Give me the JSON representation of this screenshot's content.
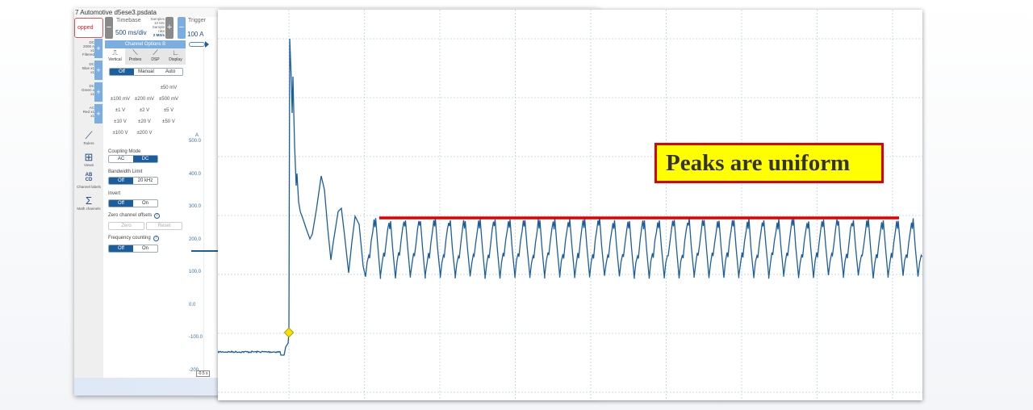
{
  "window": {
    "title": "7 Automotive d5ese3.psdata",
    "status": "opped"
  },
  "timebase": {
    "label": "Timebase",
    "value": "500 ms/div",
    "samples_label": "Samples",
    "samples": "10 MS",
    "rate_label": "Sample rate",
    "rate": "2 MS/s",
    "minus": "−",
    "plus": "+"
  },
  "trigger": {
    "label": "Trigger",
    "value": "100 A",
    "minus": "−"
  },
  "channels": [
    {
      "l1": "DC",
      "l2": "2000 A",
      "l3": "x1",
      "l4": "Filtered"
    },
    {
      "l1": "DC",
      "l2": "Blue x1",
      "l3": "x1",
      "l4": ""
    },
    {
      "l1": "DC",
      "l2": "Green x",
      "l3": "x1",
      "l4": ""
    },
    {
      "l1": "AC",
      "l2": "Red x1",
      "l3": "x1",
      "l4": ""
    }
  ],
  "channel_plus": "+",
  "tools": [
    {
      "label": "Rulers",
      "icon": "ruler-icon",
      "glyph": "⟋"
    },
    {
      "label": "Views",
      "icon": "views-grid-icon",
      "glyph": "⊞"
    },
    {
      "label": "Channel labels",
      "icon": "channel-labels-icon",
      "glyph": "AB\nCD"
    },
    {
      "label": "Math channels",
      "icon": "sigma-icon",
      "glyph": "Σ"
    }
  ],
  "panel": {
    "title": "Channel Options  B",
    "tabs": [
      {
        "label": "Vertical",
        "glyph": "⎍"
      },
      {
        "label": "Probes",
        "glyph": "⟍"
      },
      {
        "label": "DSP",
        "glyph": "⟋"
      },
      {
        "label": "Display",
        "glyph": "∟"
      }
    ],
    "range_mode": [
      "Off",
      "Manual",
      "Auto"
    ],
    "ranges": [
      "",
      "",
      "±50 mV",
      "±100 mV",
      "±200 mV",
      "±500 mV",
      "±1 V",
      "±2 V",
      "±5 V",
      "±10 V",
      "±20 V",
      "±50 V",
      "±100 V",
      "±200 V",
      ""
    ],
    "coupling": {
      "label": "Coupling Mode",
      "options": [
        "AC",
        "DC"
      ],
      "selected": "DC"
    },
    "bandwidth": {
      "label": "Bandwidth Limit",
      "options": [
        "Off",
        "20 kHz"
      ],
      "selected": "Off"
    },
    "invert": {
      "label": "Invert",
      "options": [
        "Off",
        "On"
      ],
      "selected": "Off"
    },
    "zero": {
      "label": "Zero channel offsets",
      "buttons": [
        "Zero",
        "Reset"
      ]
    },
    "freq": {
      "label": "Frequency counting",
      "options": [
        "Off",
        "On"
      ],
      "selected": "Off"
    }
  },
  "axis": {
    "unit": "A",
    "ticks": [
      "500.0",
      "400.0",
      "300.0",
      "200.0",
      "100.0",
      "0.0",
      "-100.0",
      "-200"
    ],
    "time_marker": "-0.5 s"
  },
  "chart_data": {
    "type": "line",
    "title": "",
    "xlabel": "",
    "ylabel": "",
    "grid": true,
    "series_color": "#1a5e9e",
    "annotation": {
      "text": "Peaks are uniform",
      "background": "#ffff00",
      "border": "#e00000"
    },
    "reference_line": {
      "color": "#e00000",
      "meaning": "peak level"
    },
    "trigger_marker_color": "#f5e000"
  }
}
